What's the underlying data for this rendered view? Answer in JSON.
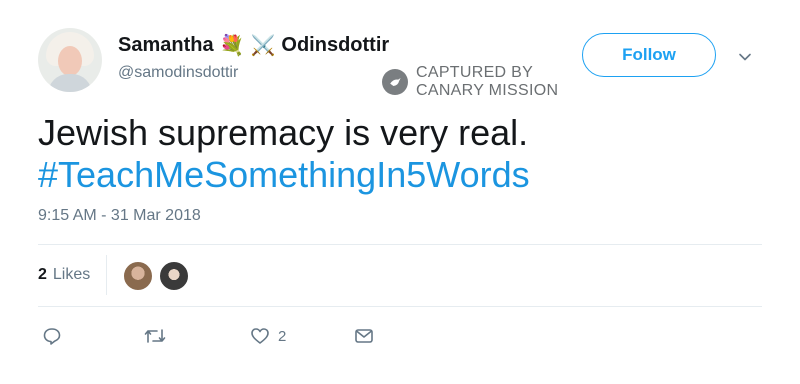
{
  "user": {
    "name_first": "Samantha",
    "name_emojis": [
      "💐",
      "⚔️"
    ],
    "name_last": "Odinsdottir",
    "handle": "@samodinsdottir"
  },
  "follow_label": "Follow",
  "watermark": {
    "line1": "CAPTURED BY",
    "line2": "CANARY MISSION"
  },
  "tweet": {
    "text": "Jewish supremacy is very real.",
    "hashtag": "#TeachMeSomethingIn5Words",
    "timestamp": "9:15 AM - 31 Mar 2018"
  },
  "likes": {
    "count": "2",
    "label": "Likes"
  },
  "actions": {
    "like_count": "2"
  },
  "colors": {
    "accent": "#1da1f2",
    "hashtag": "#1b95e0",
    "muted": "#657786"
  }
}
